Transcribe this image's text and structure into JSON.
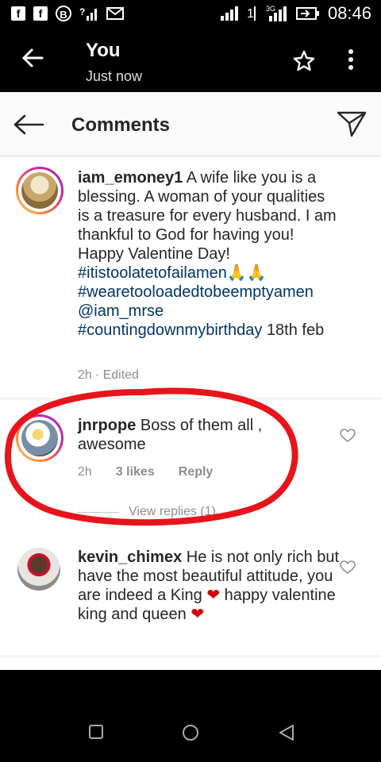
{
  "status_bar": {
    "time": "08:46",
    "icons": [
      "facebook-icon",
      "facebook-icon",
      "bitcoin-icon",
      "signal-question-icon",
      "image-message-icon",
      "signal-icon",
      "data-1-icon",
      "signal-3g-icon",
      "battery-icon"
    ],
    "left_labels": [
      "f",
      "f",
      "B"
    ]
  },
  "story_header": {
    "title": "You",
    "subtitle": "Just now"
  },
  "comments_bar": {
    "title": "Comments"
  },
  "comments": [
    {
      "username": "iam_emoney1",
      "text": " A wife like you is a blessing. A woman of your qualities is a treasure for every husband. I am thankful to God for having you! Happy Valentine Day! ",
      "tag1": "#itistoolatetofailamen",
      "emoji1": "🙏🙏",
      "tag2": "#wearetooloadedtobeemptyamen",
      "tag3": "@iam_mrse",
      "tag4": "#countingdownmybirthday",
      "tail": " 18th feb",
      "time": "2h",
      "edited": "· Edited"
    },
    {
      "username": "jnrpope",
      "text": " Boss of them all , awesome",
      "time": "2h",
      "likes": "3 likes",
      "reply": "Reply",
      "view_replies": "View replies (1)"
    },
    {
      "username": "kevin_chimex",
      "text": " He is not only rich but have the most beautiful attitude, you are indeed a King ",
      "heart1": "❤",
      "mid": " happy valentine king and queen ",
      "heart2": "❤"
    }
  ],
  "colors": {
    "accent_tag": "#003569",
    "annotation_red": "#e8141b"
  }
}
